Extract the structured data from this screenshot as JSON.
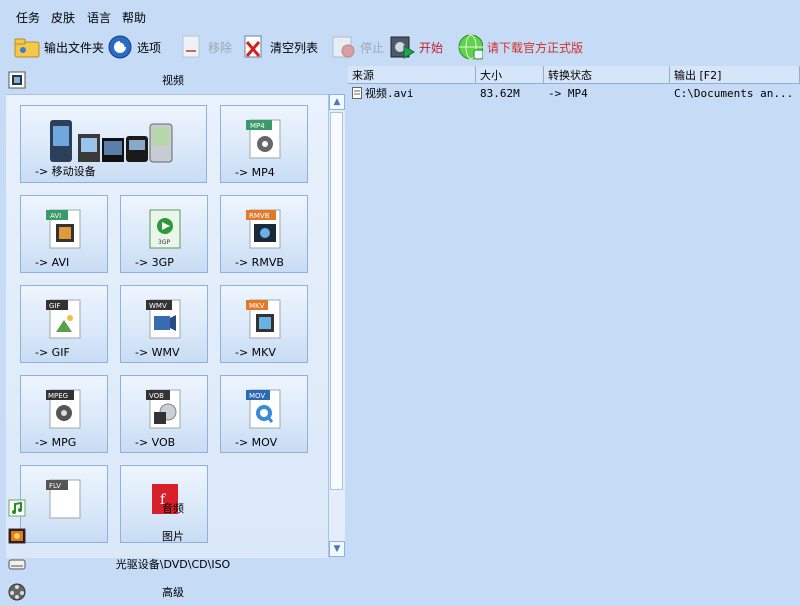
{
  "menu": [
    "任务",
    "皮肤",
    "语言",
    "帮助"
  ],
  "toolbar": {
    "output_folder": "输出文件夹",
    "options": "选项",
    "remove": "移除",
    "clear_list": "清空列表",
    "stop": "停止",
    "start": "开始",
    "download": "请下载官方正式版"
  },
  "left": {
    "video_header": "视频",
    "tiles": [
      "-> 移动设备",
      "-> MP4",
      "-> AVI",
      "-> 3GP",
      "-> RMVB",
      "-> GIF",
      "-> WMV",
      "-> MKV",
      "-> MPG",
      "-> VOB",
      "-> MOV"
    ],
    "tile_badges": [
      "MP4",
      "AVI",
      "3GP",
      "RMVB",
      "GIF",
      "WMV",
      "MKV",
      "MPEG",
      "VOB",
      "MOV",
      "FLV"
    ],
    "audio": "音频",
    "picture": "图片",
    "disc": "光驱设备\\DVD\\CD\\ISO",
    "advanced": "高级"
  },
  "table": {
    "columns": [
      "来源",
      "大小",
      "转换状态",
      "输出 [F2]"
    ],
    "rows": [
      {
        "source": "视频.avi",
        "size": "83.62M",
        "status": "-> MP4",
        "output": "C:\\Documents an..."
      }
    ]
  },
  "colors": {
    "background": "#c6dcf6",
    "tile_border": "#8cb3df",
    "start_label": "#c0202c"
  }
}
